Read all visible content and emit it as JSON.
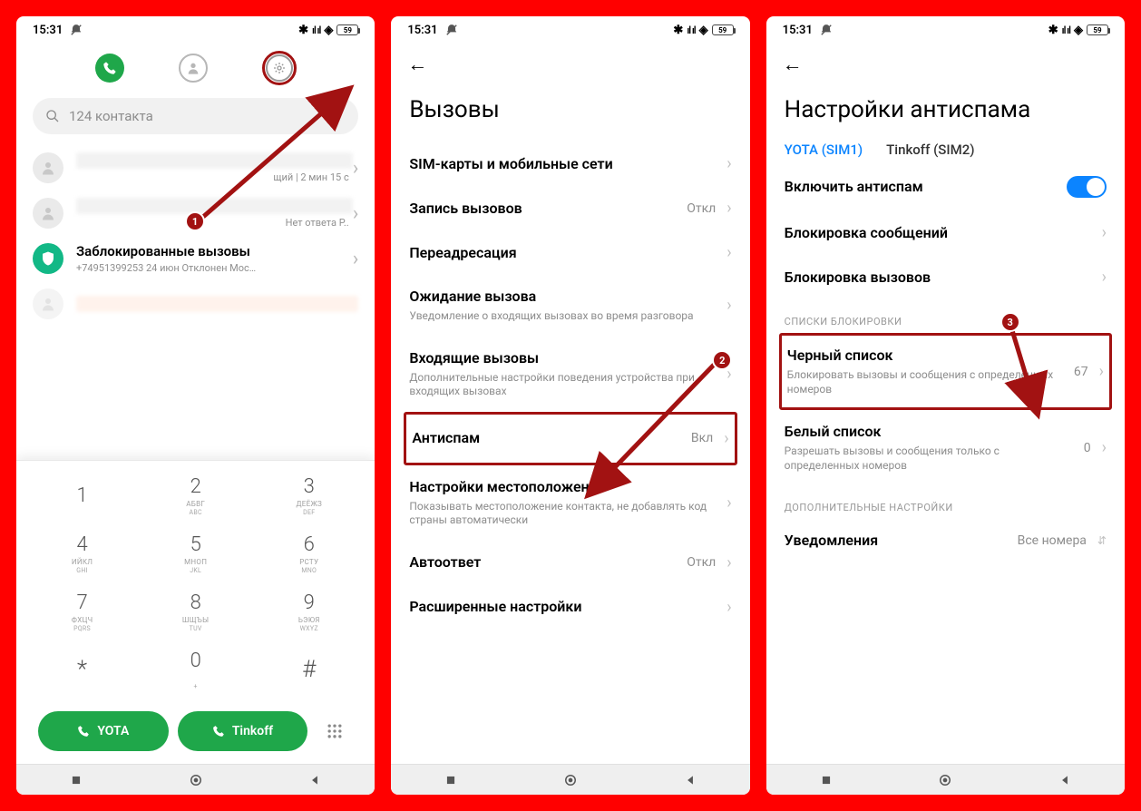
{
  "status": {
    "time": "15:31",
    "battery": "59"
  },
  "phone1": {
    "search_placeholder": "124 контакта",
    "recent1_sub": "щий | 2 мин 15 с",
    "recent2_sub": "Нет ответа Р..",
    "blocked_title": "Заблокированные вызовы",
    "blocked_sub": "+74951399253  24 июн Отклонен  Мос…",
    "keys": [
      {
        "d": "1",
        "t": "",
        "b": ""
      },
      {
        "d": "2",
        "t": "АБВГ",
        "b": "ABC"
      },
      {
        "d": "3",
        "t": "ДЕЁЖЗ",
        "b": "DEF"
      },
      {
        "d": "4",
        "t": "ИЙКЛ",
        "b": "GHI"
      },
      {
        "d": "5",
        "t": "МНОП",
        "b": "JKL"
      },
      {
        "d": "6",
        "t": "РСТУ",
        "b": "MNO"
      },
      {
        "d": "7",
        "t": "ФХЦЧ",
        "b": "PQRS"
      },
      {
        "d": "8",
        "t": "ШЩЪЫ",
        "b": "TUV"
      },
      {
        "d": "9",
        "t": "ЬЭЮЯ",
        "b": "WXYZ"
      },
      {
        "d": "*",
        "t": "",
        "b": ""
      },
      {
        "d": "0",
        "t": "",
        "b": "+"
      },
      {
        "d": "#",
        "t": "",
        "b": ""
      }
    ],
    "sim1_label": "YOTA",
    "sim2_label": "Tinkoff"
  },
  "phone2": {
    "title": "Вызовы",
    "items": [
      {
        "label": "SIM-карты и мобильные сети",
        "desc": "",
        "value": ""
      },
      {
        "label": "Запись вызовов",
        "desc": "",
        "value": "Откл"
      },
      {
        "label": "Переадресация",
        "desc": "",
        "value": ""
      },
      {
        "label": "Ожидание вызова",
        "desc": "Уведомление о входящих вызовах во время разговора",
        "value": ""
      },
      {
        "label": "Входящие вызовы",
        "desc": "Дополнительные настройки поведения устройства при входящих вызовах",
        "value": ""
      },
      {
        "label": "Антиспам",
        "desc": "",
        "value": "Вкл"
      },
      {
        "label": "Настройки местоположения",
        "desc": "Показывать местоположение контакта, не добавлять код страны автоматически",
        "value": ""
      },
      {
        "label": "Автоответ",
        "desc": "",
        "value": "Откл"
      },
      {
        "label": "Расширенные настройки",
        "desc": "",
        "value": ""
      }
    ]
  },
  "phone3": {
    "title": "Настройки антиспама",
    "sim1": "YOTA (SIM1)",
    "sim2": "Tinkoff (SIM2)",
    "enable_label": "Включить антиспам",
    "block_msg": "Блокировка сообщений",
    "block_calls": "Блокировка вызовов",
    "section1": "СПИСКИ БЛОКИРОВКИ",
    "blacklist_label": "Черный список",
    "blacklist_desc": "Блокировать вызовы и сообщения с определенных номеров",
    "blacklist_value": "67",
    "whitelist_label": "Белый список",
    "whitelist_desc": "Разрешать вызовы и сообщения только с определенных номеров",
    "whitelist_value": "0",
    "section2": "ДОПОЛНИТЕЛЬНЫЕ НАСТРОЙКИ",
    "notif_label": "Уведомления",
    "notif_value": "Все номера"
  },
  "callouts": {
    "c1": "1",
    "c2": "2",
    "c3": "3"
  }
}
